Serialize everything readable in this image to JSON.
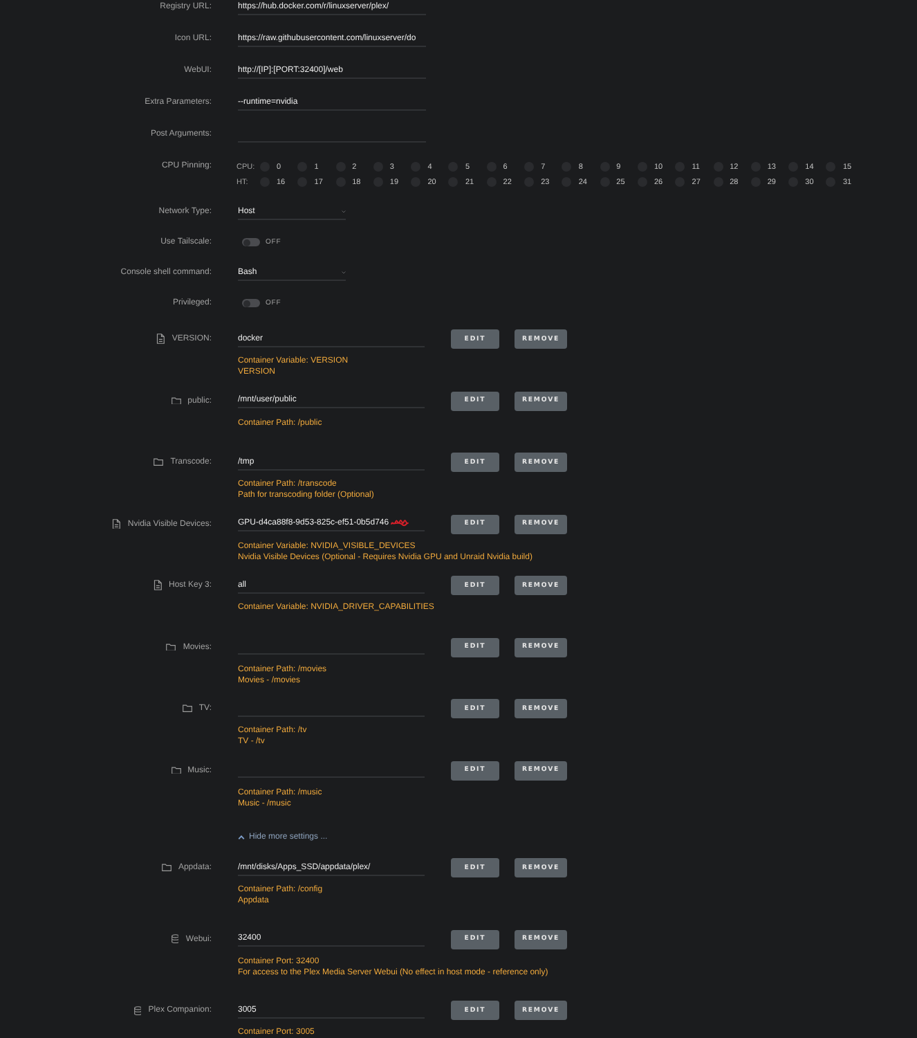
{
  "settings": [
    {
      "kind": "text",
      "label": "Registry URL:",
      "value": "https://hub.docker.com/r/linuxserver/plex/"
    },
    {
      "kind": "text",
      "label": "Icon URL:",
      "value": "https://raw.githubusercontent.com/linuxserver/do"
    },
    {
      "kind": "text",
      "label": "WebUI:",
      "value": "http://[IP]:[PORT:32400]/web"
    },
    {
      "kind": "text",
      "label": "Extra Parameters:",
      "value": "--runtime=nvidia"
    },
    {
      "kind": "text",
      "label": "Post Arguments:"
    },
    {
      "kind": "cpu",
      "label": "CPU Pinning:",
      "rows": [
        {
          "label": "CPU:",
          "cores": [
            {
              "label": "0",
              "checked": false
            },
            {
              "label": "1",
              "checked": false
            },
            {
              "label": "2",
              "checked": false
            },
            {
              "label": "3",
              "checked": false
            },
            {
              "label": "4",
              "checked": false
            },
            {
              "label": "5",
              "checked": false
            },
            {
              "label": "6",
              "checked": false
            },
            {
              "label": "7",
              "checked": false
            },
            {
              "label": "8",
              "checked": false
            },
            {
              "label": "9",
              "checked": false
            },
            {
              "label": "10",
              "checked": false
            },
            {
              "label": "11",
              "checked": false
            },
            {
              "label": "12",
              "checked": false
            },
            {
              "label": "13",
              "checked": false
            },
            {
              "label": "14",
              "checked": false
            },
            {
              "label": "15",
              "checked": false
            }
          ]
        },
        {
          "label": "HT:",
          "cores": [
            {
              "label": "16",
              "checked": false
            },
            {
              "label": "17",
              "checked": false
            },
            {
              "label": "18",
              "checked": false
            },
            {
              "label": "19",
              "checked": false
            },
            {
              "label": "20",
              "checked": false
            },
            {
              "label": "21",
              "checked": false
            },
            {
              "label": "22",
              "checked": false
            },
            {
              "label": "23",
              "checked": false
            },
            {
              "label": "24",
              "checked": false
            },
            {
              "label": "25",
              "checked": false
            },
            {
              "label": "26",
              "checked": false
            },
            {
              "label": "27",
              "checked": false
            },
            {
              "label": "28",
              "checked": false
            },
            {
              "label": "29",
              "checked": false
            },
            {
              "label": "30",
              "checked": false
            },
            {
              "label": "31",
              "checked": false
            }
          ]
        }
      ]
    },
    {
      "kind": "select",
      "label": "Network Type:",
      "value": "Host"
    },
    {
      "kind": "toggle",
      "label": "Use Tailscale:",
      "on": false,
      "state": "OFF"
    },
    {
      "kind": "select",
      "label": "Console shell command:",
      "value": "Bash"
    },
    {
      "kind": "toggle",
      "label": "Privileged:",
      "on": false,
      "state": "OFF"
    }
  ],
  "config_items": [
    {
      "kind": "variable",
      "label": "VERSION:",
      "value": "docker",
      "notes": [
        "Container Variable: VERSION",
        "VERSION"
      ],
      "buttons": [
        {
          "kind": "edit",
          "label": "EDIT"
        },
        {
          "kind": "remove",
          "label": "REMOVE"
        }
      ]
    },
    {
      "kind": "path",
      "label": "public:",
      "value": "/mnt/user/public",
      "notes": [
        "Container Path: /public"
      ],
      "buttons": [
        {
          "kind": "edit",
          "label": "EDIT"
        },
        {
          "kind": "remove",
          "label": "REMOVE"
        }
      ]
    },
    {
      "kind": "path",
      "label": "Transcode:",
      "value": "/tmp",
      "notes": [
        "Container Path: /transcode",
        "Path for transcoding folder (Optional)"
      ],
      "buttons": [
        {
          "kind": "edit",
          "label": "EDIT"
        },
        {
          "kind": "remove",
          "label": "REMOVE"
        }
      ]
    },
    {
      "kind": "variable",
      "label": "Nvidia Visible Devices:",
      "value": "GPU-d4ca88f8-9d53-825c-ef51-0b5d746",
      "redacted": true,
      "notes": [
        "Container Variable: NVIDIA_VISIBLE_DEVICES",
        "Nvidia Visible Devices (Optional - Requires Nvidia GPU and Unraid Nvidia build)"
      ],
      "buttons": [
        {
          "kind": "edit",
          "label": "EDIT"
        },
        {
          "kind": "remove",
          "label": "REMOVE"
        }
      ]
    },
    {
      "kind": "variable",
      "label": "Host Key 3:",
      "value": "all",
      "notes": [
        "Container Variable: NVIDIA_DRIVER_CAPABILITIES"
      ],
      "buttons": [
        {
          "kind": "edit",
          "label": "EDIT"
        },
        {
          "kind": "remove",
          "label": "REMOVE"
        }
      ]
    },
    {
      "kind": "path",
      "label": "Movies:",
      "notes": [
        "Container Path: /movies",
        "Movies - /movies"
      ],
      "buttons": [
        {
          "kind": "edit",
          "label": "EDIT"
        },
        {
          "kind": "remove",
          "label": "REMOVE"
        }
      ]
    },
    {
      "kind": "path",
      "label": "TV:",
      "notes": [
        "Container Path: /tv",
        "TV - /tv"
      ],
      "buttons": [
        {
          "kind": "edit",
          "label": "EDIT"
        },
        {
          "kind": "remove",
          "label": "REMOVE"
        }
      ]
    },
    {
      "kind": "path",
      "label": "Music:",
      "notes": [
        "Container Path: /music",
        "Music - /music"
      ],
      "buttons": [
        {
          "kind": "edit",
          "label": "EDIT"
        },
        {
          "kind": "remove",
          "label": "REMOVE"
        }
      ]
    }
  ],
  "more_settings_link": {
    "label": "Hide more settings ...",
    "expanded": true
  },
  "more_config_items": [
    {
      "kind": "path",
      "label": "Appdata:",
      "value": "/mnt/disks/Apps_SSD/appdata/plex/",
      "notes": [
        "Container Path: /config",
        "Appdata"
      ],
      "buttons": [
        {
          "kind": "edit",
          "label": "EDIT"
        },
        {
          "kind": "remove",
          "label": "REMOVE"
        }
      ]
    },
    {
      "kind": "port",
      "label": "Webui:",
      "value": "32400",
      "notes": [
        "Container Port: 32400",
        "For access to the Plex Media Server Webui (No effect in host mode - reference only)"
      ],
      "buttons": [
        {
          "kind": "edit",
          "label": "EDIT"
        },
        {
          "kind": "remove",
          "label": "REMOVE"
        }
      ]
    },
    {
      "kind": "port",
      "label": "Plex Companion:",
      "value": "3005",
      "notes": [
        "Container Port: 3005"
      ],
      "buttons": [
        {
          "kind": "edit",
          "label": "EDIT"
        },
        {
          "kind": "remove",
          "label": "REMOVE"
        }
      ]
    }
  ]
}
